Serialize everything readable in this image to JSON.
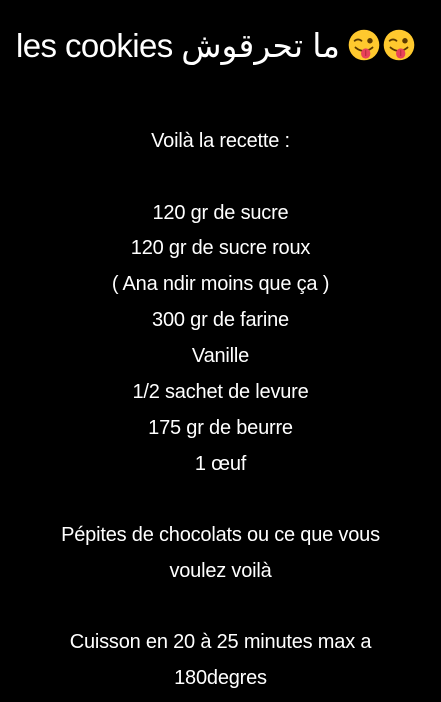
{
  "story": {
    "title": "les cookies ما تحرقوش",
    "emojis": [
      "winking-face-with-tongue",
      "winking-face-with-tongue"
    ],
    "intro": "Voilà la recette :",
    "ingredients": [
      "120 gr de sucre",
      "120 gr de sucre roux",
      "( Ana ndir moins que ça )",
      "300 gr de farine",
      "Vanille",
      "1/2 sachet de levure",
      "175 gr de beurre",
      "1 œuf"
    ],
    "extras_line1": "Pépites de chocolats ou ce que vous",
    "extras_line2": "voulez voilà",
    "cooking_line1": "Cuisson en 20 à 25 minutes max a",
    "cooking_line2": "180degres",
    "colors": {
      "background": "#000000",
      "text": "#ffffff",
      "emoji_face": "#FFC92E",
      "emoji_tongue": "#E8435A"
    }
  }
}
